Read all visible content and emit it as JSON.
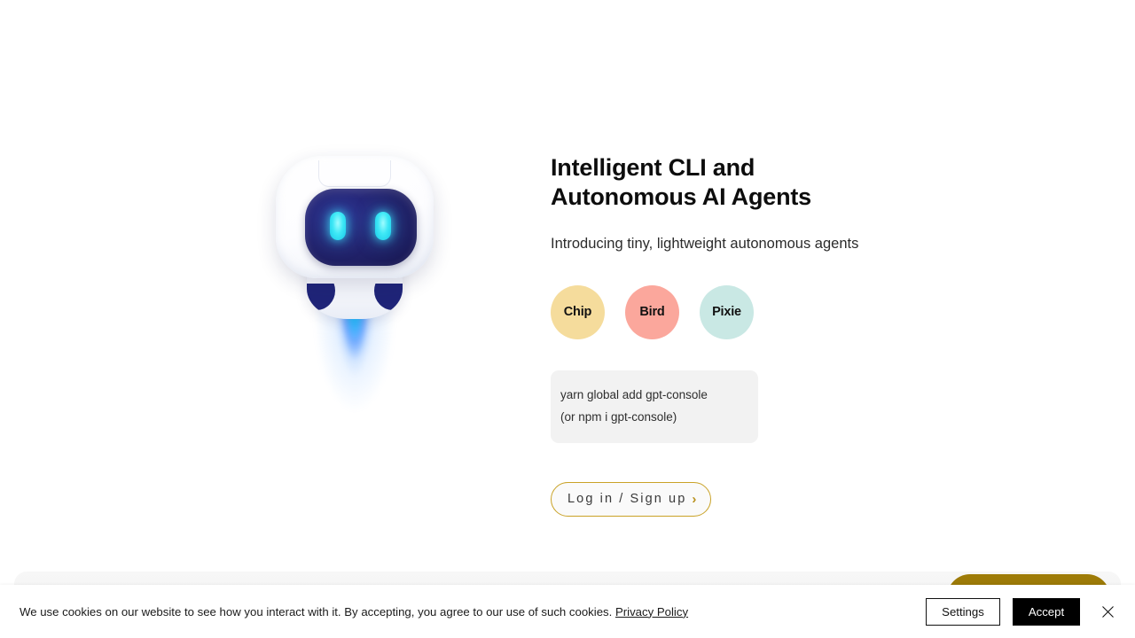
{
  "hero": {
    "mascot_name": "robot-mascot",
    "headline": "Intelligent CLI and\nAutonomous AI Agents",
    "subtitle": "Introducing tiny, lightweight autonomous agents",
    "badges": [
      {
        "label": "Chip",
        "color": "#f5dc9c"
      },
      {
        "label": "Bird",
        "color": "#fba79c"
      },
      {
        "label": "Pixie",
        "color": "#c9e8e4"
      }
    ],
    "install": {
      "line1": "yarn global add gpt-console",
      "line2": "(or npm i gpt-console)"
    },
    "cta": {
      "label": "Log in / Sign up",
      "chevron": "›",
      "border_color": "#c9a227"
    }
  },
  "floating_button": {
    "name": "gold-floating-button",
    "color": "#8a6b06"
  },
  "cookie_banner": {
    "message": "We use cookies on our website to see how you interact with it. By accepting, you agree to our use of such cookies.",
    "privacy_link": "Privacy Policy",
    "settings_label": "Settings",
    "accept_label": "Accept",
    "close_icon": "✕"
  }
}
